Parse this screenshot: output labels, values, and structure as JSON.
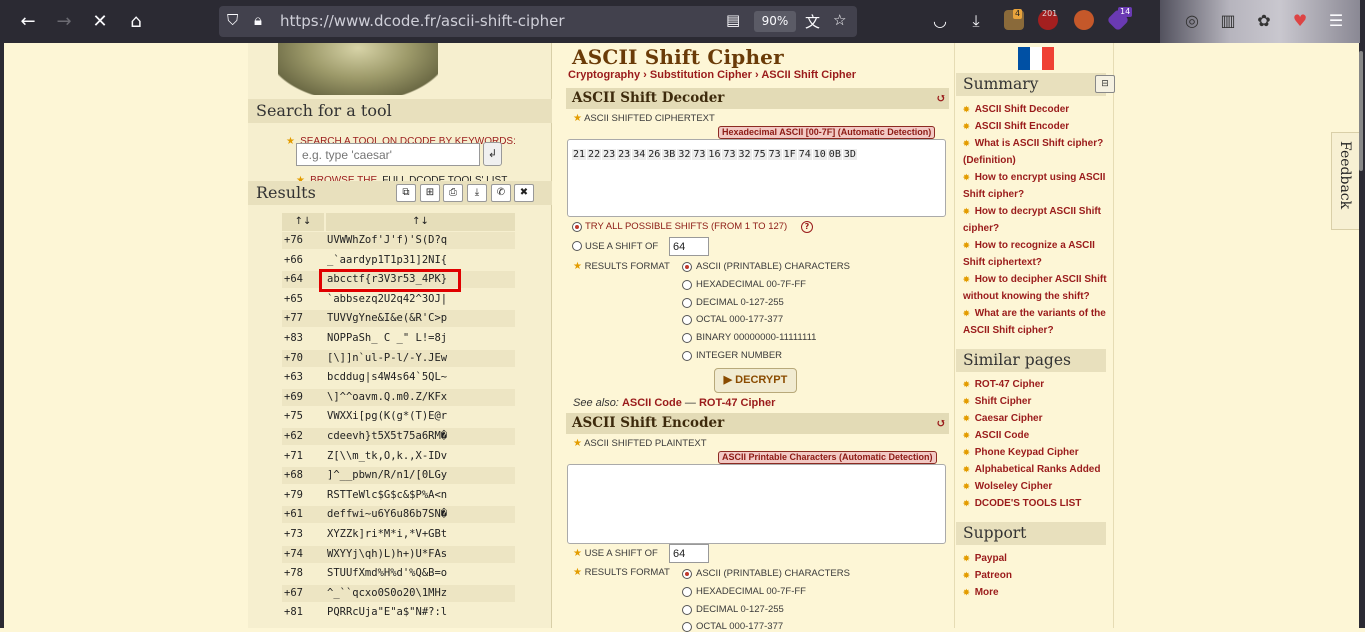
{
  "browser": {
    "url": "https://www.dcode.fr/ascii-shift-cipher",
    "zoom": "90%",
    "badge_1": "4",
    "badge_2": "201",
    "badge_3": "14"
  },
  "left": {
    "search_heading": "Search for a tool",
    "search_label": "SEARCH A TOOL ON DCODE BY KEYWORDS:",
    "search_placeholder": "e.g. type 'caesar'",
    "browse_prefix": "BROWSE THE",
    "browse_link": "FULL DCODE TOOLS' LIST",
    "results_heading": "Results",
    "col_sort_1": "↑↓",
    "col_sort_2": "↑↓",
    "rows": [
      {
        "shift": "+76",
        "text": "UVWWhZof'J'f)'S(D?q"
      },
      {
        "shift": "+66",
        "text": "_`aardyp1T1p31]2NI{"
      },
      {
        "shift": "+64",
        "text": "abcctf{r3V3r53_4PK}"
      },
      {
        "shift": "+65",
        "text": "`abbsezq2U2q42^3OJ|"
      },
      {
        "shift": "+77",
        "text": "TUVVgYne&I&e(&R'C>p"
      },
      {
        "shift": "+83",
        "text": "NOPPaSh_ C _\" L!=8j"
      },
      {
        "shift": "+70",
        "text": "[\\]]n`ul-P-l/-Y.JEw"
      },
      {
        "shift": "+63",
        "text": "bcddug|s4W4s64`5QL~"
      },
      {
        "shift": "+69",
        "text": "\\]^^oavm.Q.m0.Z/KFx"
      },
      {
        "shift": "+75",
        "text": "VWXXi[pg(K(g*(T)E@r"
      },
      {
        "shift": "+62",
        "text": "cdeevh}t5X5t75a6RM�"
      },
      {
        "shift": "+71",
        "text": "Z[\\\\m_tk,O,k.,X-IDv"
      },
      {
        "shift": "+68",
        "text": "]^__pbwn/R/n1/[0LGy"
      },
      {
        "shift": "+79",
        "text": "RSTTeWlc$G$c&$P%A<n"
      },
      {
        "shift": "+61",
        "text": "deffwi~u6Y6u86b7SN�"
      },
      {
        "shift": "+73",
        "text": "XYZZk]ri*M*i,*V+GBt"
      },
      {
        "shift": "+74",
        "text": "WXYYj\\qh)L)h+)U*FAs"
      },
      {
        "shift": "+78",
        "text": "STUUfXmd%H%d'%Q&B=o"
      },
      {
        "shift": "+67",
        "text": "^_``qcxo0S0o20\\1MHz"
      },
      {
        "shift": "+81",
        "text": "PQRRcUja\"E\"a$\"N#?:l"
      }
    ]
  },
  "main": {
    "title": "ASCII Shift Cipher",
    "breadcrumb": [
      "Cryptography",
      "Substitution Cipher",
      "ASCII Shift Cipher"
    ],
    "decoder": {
      "title": "ASCII Shift Decoder",
      "cipher_label": "ASCII SHIFTED CIPHERTEXT",
      "detection": "Hexadecimal ASCII [00-7F] (Automatic Detection)",
      "cipher_values": [
        "21",
        "22",
        "23",
        "23",
        "34",
        "26",
        "3B",
        "32",
        "73",
        "16",
        "73",
        "32",
        "75",
        "73",
        "1F",
        "74",
        "10",
        "0B",
        "3D"
      ],
      "opt_all": "TRY ALL POSSIBLE SHIFTS (FROM 1 TO 127)",
      "opt_shift": "USE A SHIFT OF",
      "shift_value": "64",
      "format_label": "RESULTS FORMAT",
      "formats": [
        "ASCII (PRINTABLE) CHARACTERS",
        "HEXADECIMAL 00-7F-FF",
        "DECIMAL 0-127-255",
        "OCTAL 000-177-377",
        "BINARY 00000000-11111111",
        "INTEGER NUMBER"
      ],
      "decrypt_label": "▶ DECRYPT",
      "see_also_prefix": "See also:",
      "see_also_1": "ASCII Code",
      "see_also_sep": "—",
      "see_also_2": "ROT-47 Cipher"
    },
    "encoder": {
      "title": "ASCII Shift Encoder",
      "plain_label": "ASCII SHIFTED PLAINTEXT",
      "detection": "ASCII Printable Characters (Automatic Detection)",
      "opt_shift": "USE A SHIFT OF",
      "shift_value": "64",
      "format_label": "RESULTS FORMAT",
      "formats": [
        "ASCII (PRINTABLE) CHARACTERS",
        "HEXADECIMAL 00-7F-FF",
        "DECIMAL 0-127-255",
        "OCTAL 000-177-377"
      ]
    }
  },
  "right": {
    "summary_title": "Summary",
    "summary_links": [
      "ASCII Shift Decoder",
      "ASCII Shift Encoder",
      "What is ASCII Shift cipher? (Definition)",
      "How to encrypt using ASCII Shift cipher?",
      "How to decrypt ASCII Shift cipher?",
      "How to recognize a ASCII Shift ciphertext?",
      "How to decipher ASCII Shift without knowing the shift?",
      "What are the variants of the ASCII Shift cipher?"
    ],
    "similar_title": "Similar pages",
    "similar_links": [
      "ROT-47 Cipher",
      "Shift Cipher",
      "Caesar Cipher",
      "ASCII Code",
      "Phone Keypad Cipher",
      "Alphabetical Ranks Added",
      "Wolseley Cipher",
      "DCODE'S TOOLS LIST"
    ],
    "support_title": "Support",
    "support_links": [
      "Paypal",
      "Patreon",
      "More"
    ],
    "feedback": "Feedback"
  }
}
